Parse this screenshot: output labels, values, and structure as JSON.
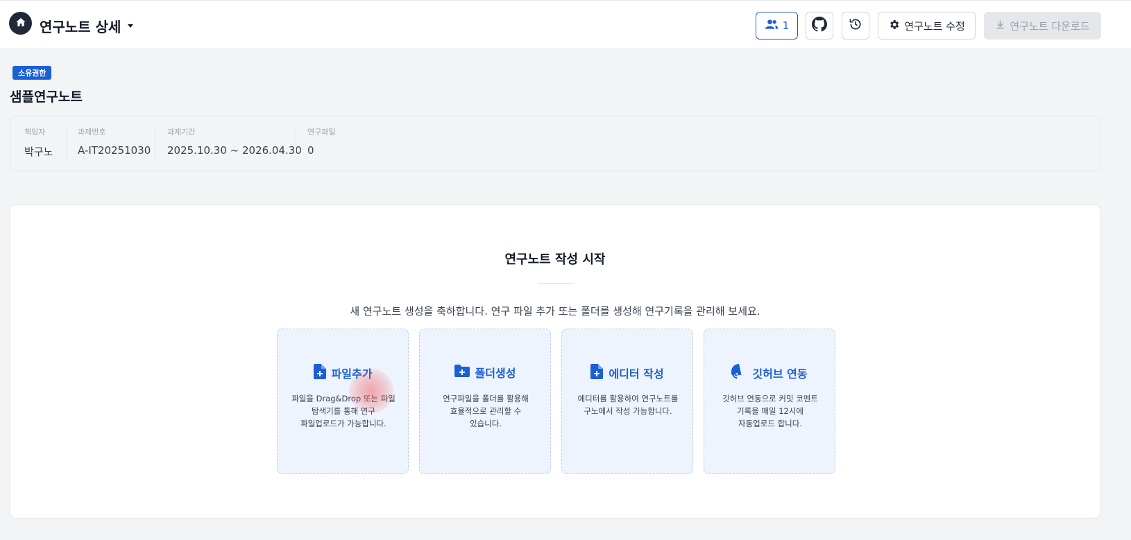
{
  "header": {
    "title": "연구노트 상세",
    "members_count": "1",
    "edit_label": "연구노트 수정",
    "download_label": "연구노트 다운로드"
  },
  "note": {
    "badge": "소유권한",
    "name": "샘플연구노트"
  },
  "info": [
    {
      "label": "책임자",
      "value": "박구노"
    },
    {
      "label": "과제번호",
      "value": "A-IT20251030"
    },
    {
      "label": "과제기간",
      "value": "2025.10.30 ~ 2026.04.30"
    },
    {
      "label": "연구파일",
      "value": "0"
    }
  ],
  "start": {
    "title": "연구노트 작성 시작",
    "description": "새 연구노트 생성을 축하합니다. 연구 파일 추가 또는 폴더를 생성해 연구기록을 관리해 보세요."
  },
  "features": [
    {
      "icon": "file-plus-icon",
      "title": "파일추가",
      "description": "파일을 Drag&Drop 또는 파일\n탐색기를 통해 연구\n파일업로드가 가능합니다."
    },
    {
      "icon": "folder-plus-icon",
      "title": "폴더생성",
      "description": "연구파일을 폴더를 활용해\n효율적으로 관리할 수\n있습니다."
    },
    {
      "icon": "file-plus-icon",
      "title": "에디터 작성",
      "description": "에디터를 활용하여 연구노트를\n구노에서 작성 가능합니다."
    },
    {
      "icon": "github-icon",
      "title": "깃허브 연동",
      "description": "깃허브 연동으로 커밋 코멘트\n기록을 매일 12시에\n자동업로드 합니다."
    }
  ],
  "colors": {
    "accent": "#1a5fd6",
    "feature_bg": "#eef4fd",
    "disabled_bg": "#e5e7eb"
  }
}
